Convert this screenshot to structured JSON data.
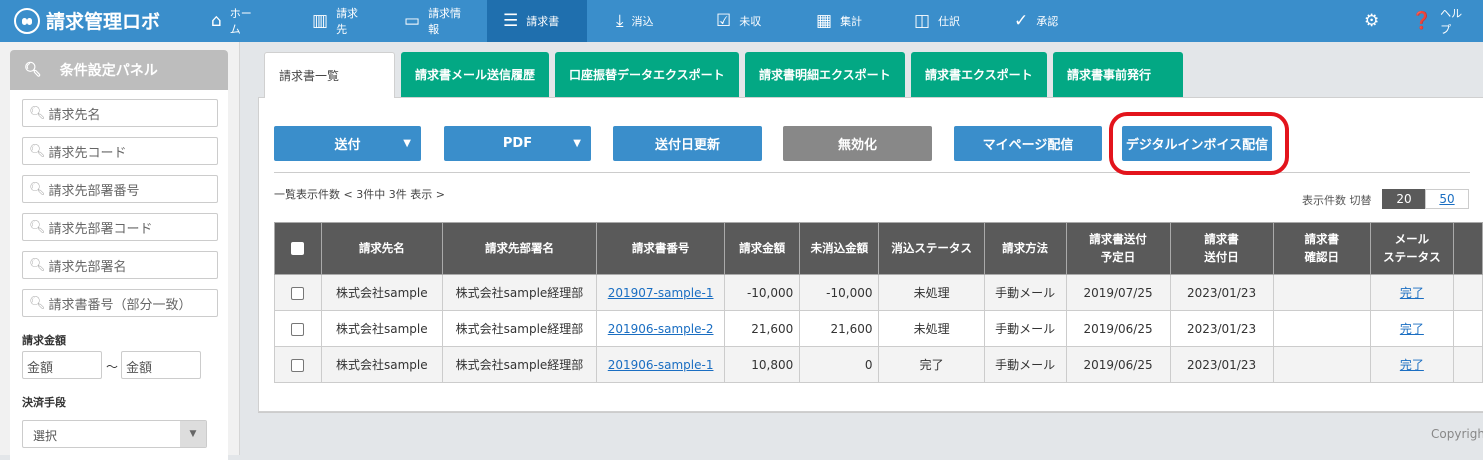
{
  "header": {
    "app_name": "請求管理ロボ",
    "nav": [
      {
        "label": "ホーム",
        "icon": "home-icon",
        "glyph": "⌂"
      },
      {
        "label": "請求先",
        "icon": "building-icon",
        "glyph": "▥"
      },
      {
        "label": "請求情報",
        "icon": "inbox-icon",
        "glyph": "▭"
      },
      {
        "label": "請求書",
        "icon": "list-icon",
        "glyph": "☰"
      },
      {
        "label": "消込",
        "icon": "download-icon",
        "glyph": "⤓"
      },
      {
        "label": "未収",
        "icon": "checkbox-icon",
        "glyph": "☑"
      },
      {
        "label": "集計",
        "icon": "calculator-icon",
        "glyph": "▦"
      },
      {
        "label": "仕訳",
        "icon": "columns-icon",
        "glyph": "◫"
      },
      {
        "label": "承認",
        "icon": "check-circle-icon",
        "glyph": "✓"
      }
    ],
    "active": "請求書",
    "help": "ヘルプ"
  },
  "sidebar": {
    "title": "条件設定パネル",
    "search_placeholders": [
      "請求先名",
      "請求先コード",
      "請求先部署番号",
      "請求先部署コード",
      "請求先部署名",
      "請求書番号（部分一致）"
    ],
    "amount_label": "請求金額",
    "amount_from_placeholder": "金額",
    "amount_sep": "～",
    "amount_to_placeholder": "金額",
    "payment_label": "決済手段",
    "payment_value": "選択"
  },
  "tabs": [
    "請求書一覧",
    "請求書メール送信履歴",
    "口座振替データエクスポート",
    "請求書明細エクスポート",
    "請求書エクスポート",
    "請求書事前発行"
  ],
  "actions": {
    "send": "送付",
    "pdf": "PDF",
    "update_date": "送付日更新",
    "invalidate": "無効化",
    "mypage": "マイページ配信",
    "digital_invoice": "デジタルインボイス配信"
  },
  "list": {
    "count_text": "一覧表示件数 < 3件中 3件 表示 >",
    "per_page_label": "表示件数 切替",
    "per_page_options": [
      "20",
      "50"
    ],
    "per_page_selected": "20"
  },
  "table": {
    "headers": [
      "請求先名",
      "請求先部署名",
      "請求書番号",
      "請求金額",
      "未消込金額",
      "消込ステータス",
      "請求方法",
      "請求書送付\n予定日",
      "請求書\n送付日",
      "請求書\n確認日",
      "メール\nステータス"
    ],
    "rows": [
      [
        "株式会社sample",
        "株式会社sample経理部",
        "201907-sample-1",
        "-10,000",
        "-10,000",
        "未処理",
        "手動メール",
        "2019/07/25",
        "2023/01/23",
        "",
        "完了"
      ],
      [
        "株式会社sample",
        "株式会社sample経理部",
        "201906-sample-2",
        "21,600",
        "21,600",
        "未処理",
        "手動メール",
        "2019/06/25",
        "2023/01/23",
        "",
        "完了"
      ],
      [
        "株式会社sample",
        "株式会社sample経理部",
        "201906-sample-1",
        "10,800",
        "0",
        "完了",
        "手動メール",
        "2019/06/25",
        "2023/01/23",
        "",
        "完了"
      ]
    ]
  },
  "footer": {
    "copyright": "Copyrigh"
  },
  "colors": {
    "header": "#3a8ecb",
    "active_nav": "#1f6fae",
    "tab_green": "#03a884",
    "button_blue": "#3a8ecb",
    "button_disabled": "#888888",
    "highlight": "#e3141c"
  }
}
